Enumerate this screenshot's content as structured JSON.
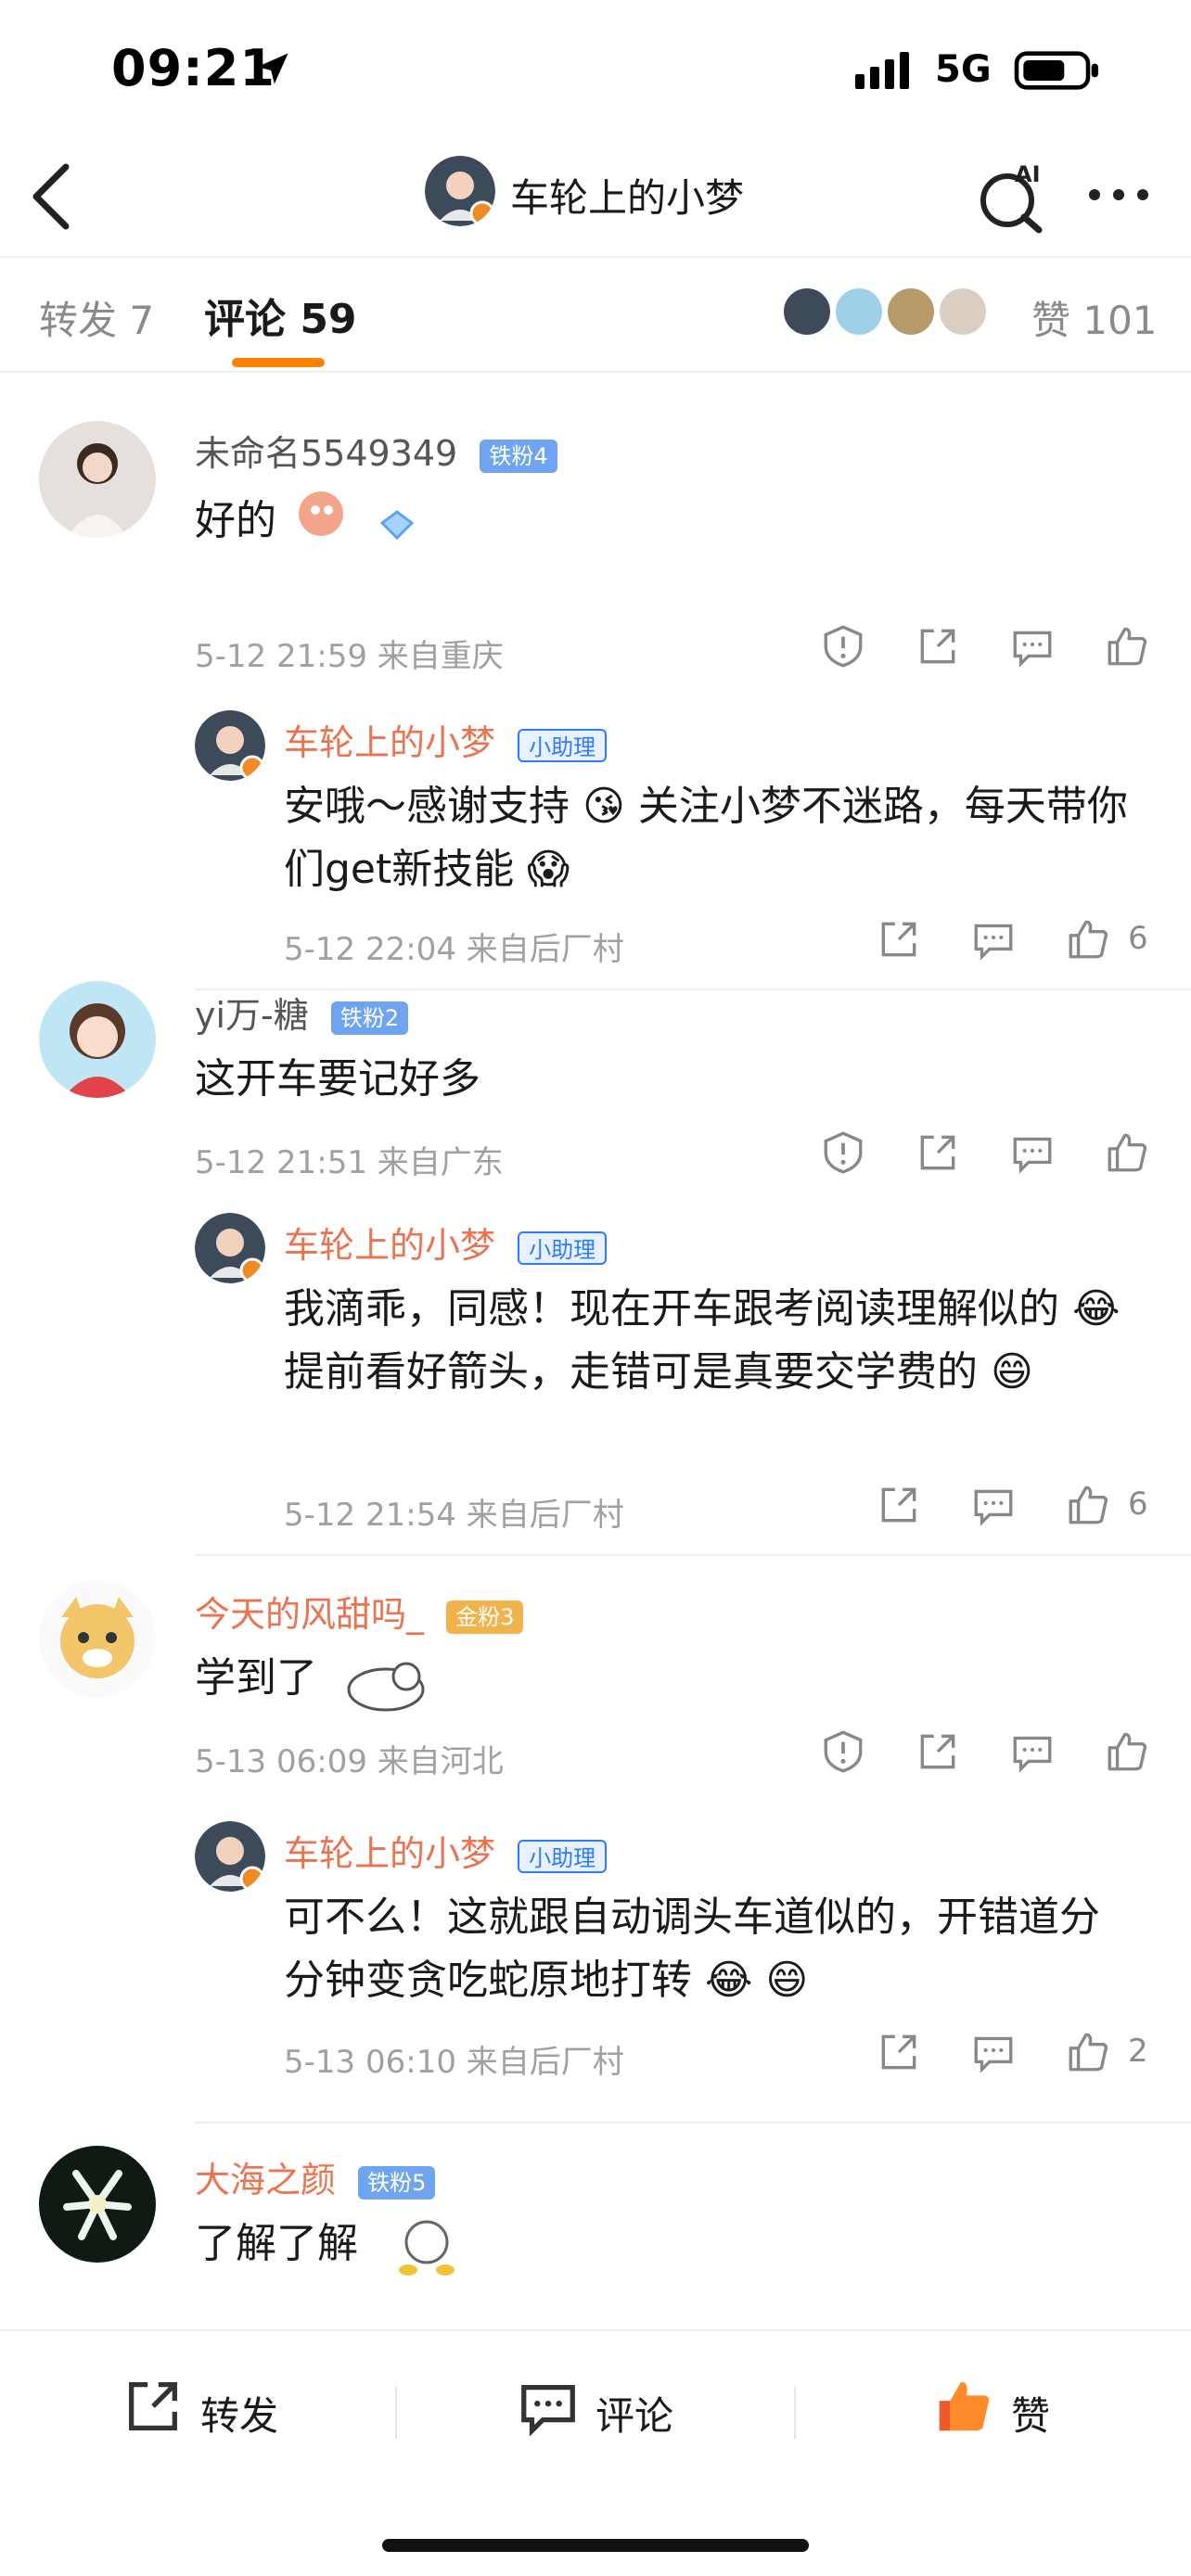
{
  "status_bar": {
    "time": "09:21",
    "network": "5G"
  },
  "nav": {
    "title": "车轮上的小梦"
  },
  "tabs": {
    "repost": "转发 7",
    "comment": "评论 59",
    "likes": "赞 101"
  },
  "colors": {
    "accent": "#ff8200",
    "vip_name": "#eb7350",
    "meta": "#a0a0a0"
  },
  "comments": [
    {
      "user": "未命名5549349",
      "badge": "铁粉4",
      "text": "好的",
      "time_loc": "5-12 21:59  来自重庆",
      "reply": {
        "user": "车轮上的小梦",
        "badge": "小助理",
        "text": "安哦～感谢支持 😘 关注小梦不迷路，每天带你们get新技能 😱",
        "time_loc": "5-12 22:04  来自后厂村",
        "likes": "6"
      }
    },
    {
      "user": "yi万-糖",
      "badge": "铁粉2",
      "text": "这开车要记好多",
      "time_loc": "5-12 21:51  来自广东",
      "reply": {
        "user": "车轮上的小梦",
        "badge": "小助理",
        "text": "我滴乖，同感！现在开车跟考阅读理解似的 😂 提前看好箭头，走错可是真要交学费的 😄",
        "time_loc": "5-12 21:54  来自后厂村",
        "likes": "6"
      }
    },
    {
      "user": "今天的风甜吗_",
      "badge": "金粉3",
      "text": "学到了",
      "time_loc": "5-13 06:09  来自河北",
      "reply": {
        "user": "车轮上的小梦",
        "badge": "小助理",
        "text": "可不么！这就跟自动调头车道似的，开错道分分钟变贪吃蛇原地打转 😂 😄",
        "time_loc": "5-13 06:10  来自后厂村",
        "likes": "2"
      }
    },
    {
      "user": "大海之颜",
      "badge": "铁粉5",
      "text": "了解了解"
    }
  ],
  "bottom_bar": {
    "repost": "转发",
    "comment": "评论",
    "like": "赞"
  },
  "icons": [
    "location-arrow-icon",
    "signal-icon",
    "battery-icon",
    "back-icon",
    "ai-search-icon",
    "more-icon",
    "report-icon",
    "share-icon",
    "comment-icon",
    "like-icon"
  ]
}
